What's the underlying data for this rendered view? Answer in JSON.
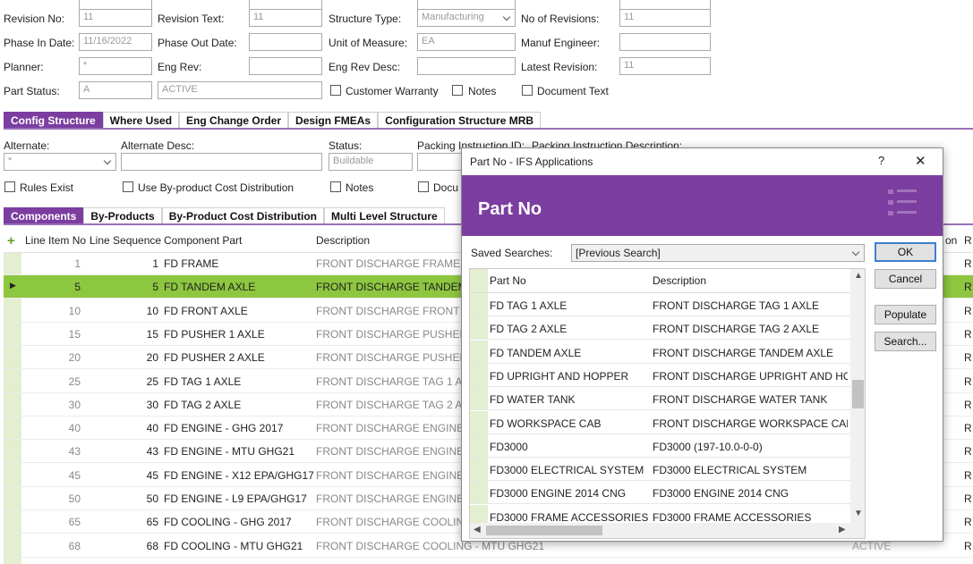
{
  "form": {
    "revision_no_label": "Revision No:",
    "revision_no_value": "11",
    "revision_text_label": "Revision Text:",
    "revision_text_value": "11",
    "structure_type_label": "Structure Type:",
    "structure_type_value": "Manufacturing",
    "no_of_revisions_label": "No of Revisions:",
    "no_of_revisions_value": "11",
    "phase_in_label": "Phase In Date:",
    "phase_in_value": "11/16/2022",
    "phase_out_label": "Phase Out Date:",
    "phase_out_value": "",
    "uom_label": "Unit of Measure:",
    "uom_value": "EA",
    "manuf_engineer_label": "Manuf Engineer:",
    "manuf_engineer_value": "",
    "planner_label": "Planner:",
    "planner_value": "*",
    "eng_rev_label": "Eng Rev:",
    "eng_rev_value": "",
    "eng_rev_desc_label": "Eng Rev Desc:",
    "eng_rev_desc_value": "",
    "latest_revision_label": "Latest Revision:",
    "latest_revision_value": "11",
    "part_status_label": "Part Status:",
    "part_status_value": "A",
    "part_status_desc": "ACTIVE",
    "customer_warranty_label": "Customer Warranty",
    "notes_label": "Notes",
    "document_text_label": "Document Text"
  },
  "main_tabs": [
    "Config Structure",
    "Where Used",
    "Eng Change Order",
    "Design FMEAs",
    "Configuration Structure MRB"
  ],
  "config": {
    "alternate_label": "Alternate:",
    "alternate_value": "*",
    "alternate_desc_label": "Alternate Desc:",
    "alternate_desc_value": "",
    "status_label": "Status:",
    "status_value": "Buildable",
    "packing_id_label": "Packing Instruction ID:",
    "packing_desc_label": "Packing Instruction Description:",
    "rules_exist_label": "Rules Exist",
    "byproduct_cost_label": "Use By-product Cost Distribution",
    "notes_label": "Notes",
    "docu_label": "Docu"
  },
  "sub_tabs": [
    "Components",
    "By-Products",
    "By-Product Cost Distribution",
    "Multi Level Structure"
  ],
  "grid": {
    "headers": {
      "line_item": "Line Item No",
      "line_seq": "Line Sequence",
      "component": "Component Part",
      "description": "Description",
      "extra": "on",
      "r": "R"
    },
    "rows": [
      {
        "line": "1",
        "seq": "1",
        "comp": "FD FRAME",
        "desc": "FRONT DISCHARGE FRAME",
        "r": "R"
      },
      {
        "line": "5",
        "seq": "5",
        "comp": "FD TANDEM AXLE",
        "desc": "FRONT DISCHARGE TANDEM A",
        "r": "R",
        "selected": true
      },
      {
        "line": "10",
        "seq": "10",
        "comp": "FD FRONT AXLE",
        "desc": "FRONT DISCHARGE FRONT AX",
        "r": "R"
      },
      {
        "line": "15",
        "seq": "15",
        "comp": "FD PUSHER 1 AXLE",
        "desc": "FRONT DISCHARGE PUSHER 1",
        "r": "R"
      },
      {
        "line": "20",
        "seq": "20",
        "comp": "FD PUSHER 2 AXLE",
        "desc": "FRONT DISCHARGE PUSHER 2",
        "r": "R"
      },
      {
        "line": "25",
        "seq": "25",
        "comp": "FD TAG 1 AXLE",
        "desc": "FRONT DISCHARGE TAG 1 AXL",
        "r": "R"
      },
      {
        "line": "30",
        "seq": "30",
        "comp": "FD TAG 2 AXLE",
        "desc": "FRONT DISCHARGE TAG 2 AXL",
        "r": "R"
      },
      {
        "line": "40",
        "seq": "40",
        "comp": "FD ENGINE - GHG 2017",
        "desc": "FRONT DISCHARGE ENGINE - (",
        "r": "R"
      },
      {
        "line": "43",
        "seq": "43",
        "comp": "FD ENGINE - MTU GHG21",
        "desc": "FRONT DISCHARGE ENGINE - I",
        "r": "R"
      },
      {
        "line": "45",
        "seq": "45",
        "comp": "FD ENGINE - X12 EPA/GHG17",
        "desc": "FRONT DISCHARGE ENGINE - )",
        "r": "R"
      },
      {
        "line": "50",
        "seq": "50",
        "comp": "FD ENGINE - L9 EPA/GHG17",
        "desc": "FRONT DISCHARGE ENGINE - L",
        "r": "R"
      },
      {
        "line": "65",
        "seq": "65",
        "comp": "FD COOLING - GHG 2017",
        "desc": "FRONT DISCHARGE COOLING",
        "r": "R"
      },
      {
        "line": "68",
        "seq": "68",
        "comp": "FD COOLING - MTU GHG21",
        "desc": "FRONT DISCHARGE COOLING - MTU GHG21",
        "r": "R",
        "status": "ACTIVE"
      }
    ]
  },
  "dialog": {
    "title": "Part No  - IFS Applications",
    "help": "?",
    "close": "✕",
    "header": "Part No",
    "saved_searches_label": "Saved Searches:",
    "saved_searches_value": "[Previous Search]",
    "col_part": "Part No",
    "col_desc": "Description",
    "ok": "OK",
    "cancel": "Cancel",
    "populate": "Populate",
    "search": "Search...",
    "rows": [
      {
        "part": "FD TAG 1 AXLE",
        "desc": "FRONT DISCHARGE TAG 1 AXLE"
      },
      {
        "part": "FD TAG 2 AXLE",
        "desc": "FRONT DISCHARGE TAG 2 AXLE"
      },
      {
        "part": "FD TANDEM AXLE",
        "desc": "FRONT DISCHARGE TANDEM AXLE"
      },
      {
        "part": "FD UPRIGHT AND HOPPER",
        "desc": "FRONT DISCHARGE UPRIGHT AND HOP..."
      },
      {
        "part": "FD WATER TANK",
        "desc": "FRONT DISCHARGE WATER TANK"
      },
      {
        "part": "FD WORKSPACE CAB",
        "desc": "FRONT DISCHARGE WORKSPACE CAB"
      },
      {
        "part": "FD3000",
        "desc": "FD3000 (197-10.0-0-0)"
      },
      {
        "part": "FD3000 ELECTRICAL SYSTEM",
        "desc": "FD3000 ELECTRICAL SYSTEM"
      },
      {
        "part": "FD3000 ENGINE 2014 CNG",
        "desc": "FD3000 ENGINE 2014 CNG"
      },
      {
        "part": "FD3000 FRAME ACCESSORIES",
        "desc": "FD3000 FRAME ACCESSORIES"
      }
    ]
  }
}
